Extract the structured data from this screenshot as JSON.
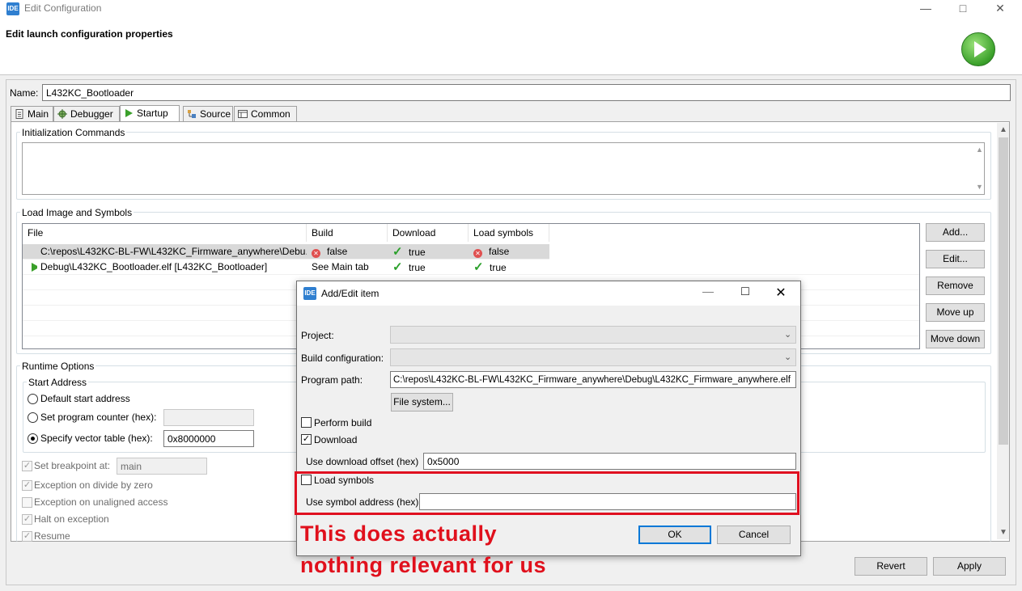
{
  "window": {
    "title": "Edit Configuration",
    "app_icon_text": "IDE",
    "heading": "Edit launch configuration properties"
  },
  "name_row": {
    "label": "Name:",
    "value": "L432KC_Bootloader"
  },
  "tabs": [
    {
      "label": "Main",
      "icon": "document-icon"
    },
    {
      "label": "Debugger",
      "icon": "bug-gear-icon"
    },
    {
      "label": "Startup",
      "icon": "play-icon"
    },
    {
      "label": "Source",
      "icon": "source-icon"
    },
    {
      "label": "Common",
      "icon": "common-icon"
    }
  ],
  "init_commands": {
    "title": "Initialization Commands",
    "value": ""
  },
  "load_image": {
    "title": "Load Image and Symbols",
    "columns": [
      "File",
      "Build",
      "Download",
      "Load symbols"
    ],
    "rows": [
      {
        "file": "C:\\repos\\L432KC-BL-FW\\L432KC_Firmware_anywhere\\Debu...",
        "build": "false",
        "download": "true",
        "load_symbols": "false"
      },
      {
        "file": "Debug\\L432KC_Bootloader.elf [L432KC_Bootloader]",
        "build": "See Main tab",
        "download": "true",
        "load_symbols": "true"
      }
    ],
    "buttons": {
      "add": "Add...",
      "edit": "Edit...",
      "remove": "Remove",
      "move_up": "Move up",
      "move_down": "Move down"
    }
  },
  "runtime": {
    "title": "Runtime Options",
    "start_address_title": "Start Address",
    "default_start": "Default start address",
    "set_pc": "Set program counter (hex):",
    "set_pc_value": "",
    "vector_table": "Specify vector table (hex):",
    "vector_table_value": "0x8000000",
    "set_breakpoint": "Set breakpoint at:",
    "breakpoint_value": "main",
    "exc_div_zero": "Exception on divide by zero",
    "exc_unaligned": "Exception on unaligned access",
    "halt_on_exc": "Halt on exception",
    "resume": "Resume"
  },
  "footer": {
    "revert": "Revert",
    "apply": "Apply"
  },
  "dialog": {
    "title": "Add/Edit item",
    "project_label": "Project:",
    "build_config_label": "Build configuration:",
    "program_path_label": "Program path:",
    "program_path_value": "C:\\repos\\L432KC-BL-FW\\L432KC_Firmware_anywhere\\Debug\\L432KC_Firmware_anywhere.elf",
    "file_system_button": "File system...",
    "perform_build": "Perform build",
    "download": "Download",
    "download_offset_label": "Use download offset (hex)",
    "download_offset_value": "0x5000",
    "load_symbols": "Load symbols",
    "symbol_address_label": "Use symbol address (hex)",
    "symbol_address_value": "",
    "ok": "OK",
    "cancel": "Cancel"
  },
  "annotation": {
    "line1": "This does actually",
    "line2": "nothing relevant for us"
  }
}
